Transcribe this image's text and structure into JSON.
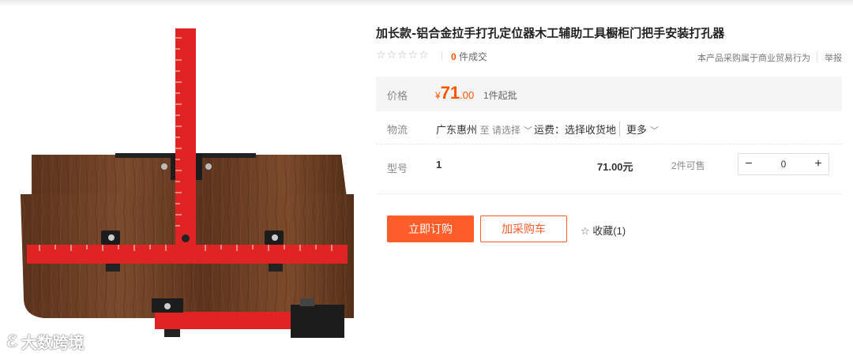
{
  "product": {
    "title": "加长款-铝合金拉手打孔定位器木工辅助工具橱柜门把手安装打孔器",
    "stars": "☆☆☆☆☆",
    "sold_count": "0",
    "sold_suffix": "件成交",
    "trade_note": "本产品采购属于商业贸易行为",
    "report": "举报"
  },
  "price": {
    "label": "价格",
    "currency": "¥",
    "integer": "71",
    "decimal": ".00",
    "moq": "1件起批"
  },
  "logistics": {
    "label": "物流",
    "origin": "广东惠州",
    "to": "至 请选择",
    "freight": "运费：选择收货地",
    "more": "更多"
  },
  "sku": {
    "label": "型号",
    "name": "1",
    "price": "71.00元",
    "stock": "2件可售",
    "qty": "0",
    "minus": "−",
    "plus": "+"
  },
  "actions": {
    "buy": "立即订购",
    "cart": "加采购车",
    "favorite": "收藏(1)"
  },
  "watermark": {
    "text": "大数跨境"
  },
  "colors": {
    "accent": "#ff5500",
    "button": "#ff5d2a",
    "ruler": "#e02424",
    "wood": "#6b3f24"
  }
}
